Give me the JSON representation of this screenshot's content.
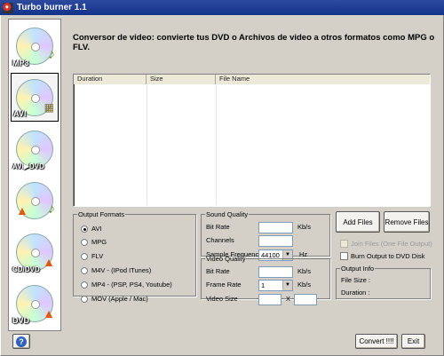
{
  "window": {
    "title": "Turbo burner 1.1"
  },
  "sidebar": {
    "items": [
      {
        "label": "MP3",
        "icon": "music-note-icon",
        "accent": "♪",
        "color": "#5a9a2a"
      },
      {
        "label": "AVI",
        "icon": "film-icon",
        "accent": "▦",
        "color": "#7a6a2a"
      },
      {
        "label": "AVI▶DVD",
        "icon": "disc-arrow-icon",
        "accent": "",
        "color": "#d8b000"
      },
      {
        "label": "",
        "icon": "flame-icon",
        "accent": "♪",
        "color": "#e05a10"
      },
      {
        "label": "CD/DVD",
        "icon": "flame-icon",
        "accent": "🔥",
        "color": "#e05a10"
      },
      {
        "label": "DVD",
        "icon": "flame-icon",
        "accent": "🔥",
        "color": "#e05a10"
      }
    ]
  },
  "heading": "Conversor de video: convierte tus DVD o Archivos de video a otros formatos como MPG o FLV.",
  "file_list": {
    "columns": [
      "Duration",
      "Size",
      "File Name"
    ],
    "rows": []
  },
  "output_formats": {
    "legend": "Output Formats",
    "options": [
      "AVI",
      "MPG",
      "FLV",
      "M4V - (IPod ITunes)",
      "MP4 - (PSP, PS4, Youtube)",
      "MOV (Apple / Mac)"
    ],
    "selected": "AVI"
  },
  "sound_quality": {
    "legend": "Sound Quality",
    "bit_rate_label": "Bit Rate",
    "bit_rate_value": "",
    "bit_rate_unit": "Kb/s",
    "channels_label": "Channels",
    "channels_value": "",
    "sample_freq_label": "Sample Frequency",
    "sample_freq_value": "44100",
    "sample_freq_unit": "Hz"
  },
  "video_quality": {
    "legend": "Video Quality",
    "bit_rate_label": "Bit Rate",
    "bit_rate_value": "",
    "bit_rate_unit": "Kb/s",
    "frame_rate_label": "Frame Rate",
    "frame_rate_value": "1",
    "frame_rate_unit": "Kb/s",
    "video_size_label": "Video Size",
    "video_size_w": "",
    "video_size_sep": "X",
    "video_size_h": ""
  },
  "buttons": {
    "add_files": "Add Files",
    "remove_files": "Remove Files",
    "convert": "Convert !!!!",
    "exit": "Exit",
    "help": "?"
  },
  "options": {
    "join_files": "Join Files (One File Output)",
    "burn_output": "Burn Output to DVD Disk"
  },
  "output_info": {
    "legend": "Output Info",
    "file_size_label": "File Size :",
    "duration_label": "Duration :"
  }
}
